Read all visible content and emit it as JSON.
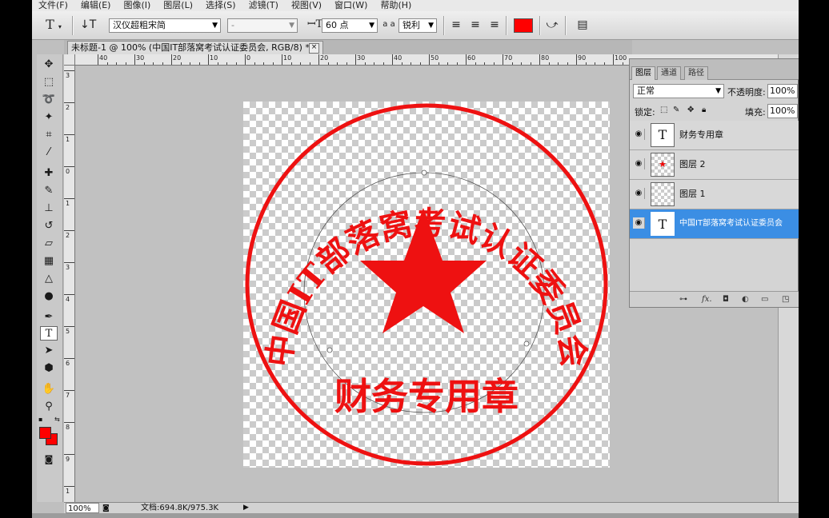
{
  "menu": [
    "文件(F)",
    "编辑(E)",
    "图像(I)",
    "图层(L)",
    "选择(S)",
    "滤镜(T)",
    "视图(V)",
    "窗口(W)",
    "帮助(H)"
  ],
  "options": {
    "tool_glyph": "T",
    "font_family": "汉仪超粗宋简",
    "font_style": "-",
    "font_size": "60 点",
    "aa_label": "a a",
    "aa_mode": "锐利",
    "text_color": "#ff0000"
  },
  "document": {
    "tab_title": "未标题-1 @ 100% (中国IT部落窝考试认证委员会, RGB/8) *",
    "close_glyph": "×"
  },
  "ruler": {
    "top_numbers": [
      "40",
      "30",
      "20",
      "10",
      "0",
      "10",
      "20",
      "30",
      "40",
      "50",
      "60",
      "70",
      "80",
      "90",
      "100"
    ],
    "left_numbers": [
      "3",
      "2",
      "1",
      "0",
      "1",
      "2",
      "3",
      "4",
      "5",
      "6",
      "7",
      "8",
      "9",
      "1"
    ]
  },
  "seal": {
    "color": "#ee1111",
    "arc_text": "中国IT部落窝考试认证委员会",
    "bottom_text": "财务专用章"
  },
  "layers_panel": {
    "tabs": [
      "图层",
      "通道",
      "路径"
    ],
    "blend_mode": "正常",
    "opacity_label": "不透明度:",
    "opacity_value": "100%",
    "lock_label": "锁定:",
    "fill_label": "填充:",
    "fill_value": "100%",
    "layers": [
      {
        "name": "财务专用章",
        "thumb": "T",
        "selected": false
      },
      {
        "name": "图层 2",
        "thumb": "star",
        "selected": false
      },
      {
        "name": "图层 1",
        "thumb": "checker",
        "selected": false
      },
      {
        "name": "中国IT部落窝考试认证委员会",
        "thumb": "T",
        "selected": true
      }
    ]
  },
  "status": {
    "zoom": "100%",
    "doc_info": "文档:694.8K/975.3K"
  }
}
